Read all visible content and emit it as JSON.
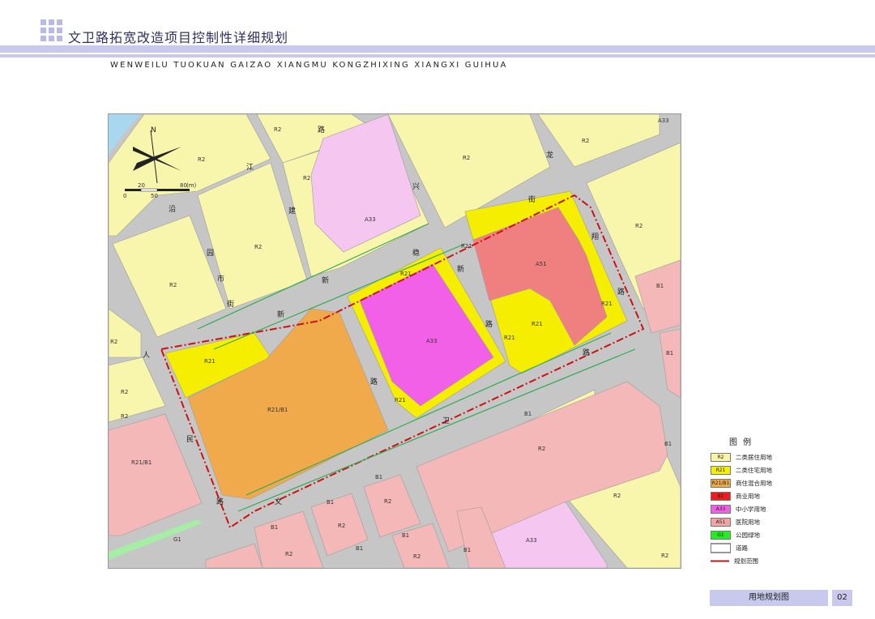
{
  "header": {
    "title": "文卫路拓宽改造项目控制性详细规划",
    "subtitle": "WENWEILU TUOKUAN GAIZAO XIANGMU KONGZHIXING XIANGXI GUIHUA"
  },
  "map": {
    "north_label": "N",
    "scale_labels": {
      "a": "20",
      "b": "80",
      "unit": "(m)",
      "c": "0",
      "d": "50"
    },
    "road_chars": {
      "r1": "路",
      "r2": "江",
      "r3": "沿",
      "r4": "建",
      "r5": "兴",
      "r6": "龙",
      "r7": "街",
      "r8": "路",
      "r9": "翔",
      "r10": "路",
      "r11": "路",
      "r12": "园",
      "r13": "新",
      "r14": "新",
      "r15": "稳",
      "r16": "市",
      "r17": "街",
      "r18": "路",
      "r19": "路",
      "r20": "卫",
      "r21": "文",
      "r22": "路",
      "r23": "民",
      "r24": "人",
      "r25": "路"
    },
    "lots": {
      "r2_a": "R2",
      "r2_b": "R2",
      "r2_c": "R2",
      "r2_d": "R2",
      "r2_e": "R2",
      "r2_f": "R2",
      "r2_g": "R2",
      "r2_h": "R2",
      "r2_i": "R2",
      "r2_j": "R2",
      "r2_k": "R2",
      "r2_l": "R2",
      "r2_m": "R2",
      "r2_n": "R2",
      "r2_o": "R2",
      "r2_p": "R2",
      "r2_q": "R2",
      "a33_a": "A33",
      "a33_b": "A33",
      "a33_c": "A33",
      "a33_d": "A33",
      "r21_a": "R21",
      "r21_b": "R21",
      "r21_c": "R21",
      "r21_d": "R21",
      "r21_e": "R21",
      "r21_f": "R21",
      "r21_g": "R21",
      "a51": "A51",
      "r21b1_a": "R21/B1",
      "r21b1_b": "R21/B1",
      "b1_a": "B1",
      "b1_b": "B1",
      "b1_c": "B1",
      "b1_d": "B1",
      "b1_e": "B1",
      "b1_f": "B1",
      "b1_g": "B1",
      "b1_h": "B1",
      "b1_i": "B1",
      "b1_j": "B1",
      "g1": "G1",
      "r2_x": "R2"
    }
  },
  "legend": {
    "title": "图 例",
    "items": [
      {
        "code": "R2",
        "label": "二类居住用地",
        "color": "#f8f5a4"
      },
      {
        "code": "R21",
        "label": "二类住宅用地",
        "color": "#f5f000"
      },
      {
        "code": "R21/B1",
        "label": "商住混合用地",
        "color": "#efaa48"
      },
      {
        "code": "B1",
        "label": "商业用地",
        "color": "#ee1c1c"
      },
      {
        "code": "A33",
        "label": "中小学用地",
        "color": "#f060e6"
      },
      {
        "code": "A51",
        "label": "医院用地",
        "color": "#f4a2a2"
      },
      {
        "code": "G1",
        "label": "公园绿地",
        "color": "#22ee22"
      },
      {
        "code": "",
        "label": "道路",
        "color": "#ffffff"
      },
      {
        "code": "",
        "label": "规划范围",
        "color": "#ffffff"
      }
    ]
  },
  "footer": {
    "label": "用地规划图",
    "page": "02"
  }
}
